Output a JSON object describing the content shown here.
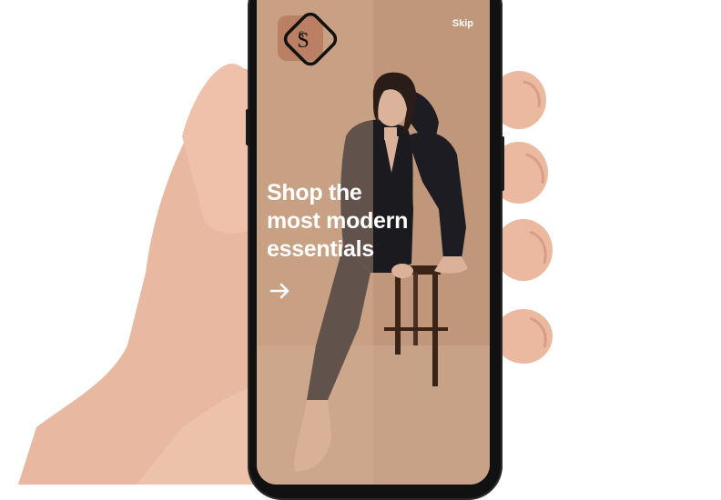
{
  "onboarding": {
    "logo_alt": "S monogram logo",
    "skip_label": "Skip",
    "headline_lines": [
      "Shop the",
      "most modern",
      "essentials"
    ],
    "next_icon": "arrow-right-icon"
  },
  "colors": {
    "background": "#ffffff",
    "screen_tan": "#c39a7c",
    "text": "#ffffff",
    "suit": "#1a1a1f",
    "logo_bg": "#b97b5f",
    "phone_frame": "#111111"
  }
}
